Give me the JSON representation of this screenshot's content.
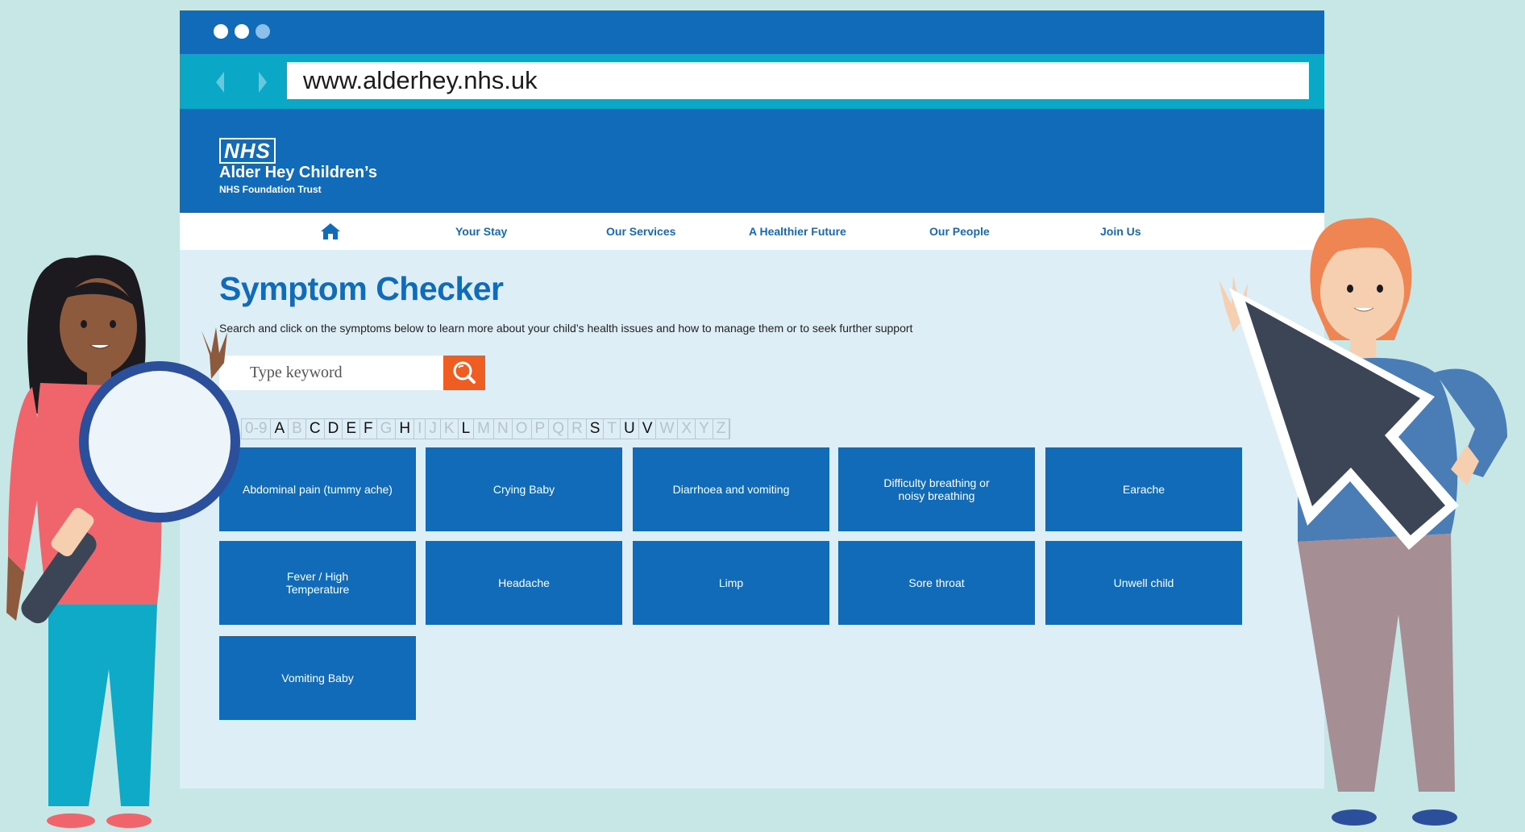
{
  "browser": {
    "url": "www.alderhey.nhs.uk"
  },
  "header": {
    "logo": "NHS",
    "trust_name": "Alder Hey Children’s",
    "trust_sub": "NHS Foundation Trust"
  },
  "nav": {
    "items": [
      "Your Stay",
      "Our Services",
      "A Healthier Future",
      "Our People",
      "Join Us"
    ]
  },
  "main": {
    "title": "Symptom Checker",
    "description": "Search and click on the symptoms below to learn more about your child’s health issues and how to manage them or to seek further support",
    "search_placeholder": "Type keyword"
  },
  "alphabet": [
    {
      "label": "0-9",
      "active": false
    },
    {
      "label": "A",
      "active": true
    },
    {
      "label": "B",
      "active": false
    },
    {
      "label": "C",
      "active": true
    },
    {
      "label": "D",
      "active": true
    },
    {
      "label": "E",
      "active": true
    },
    {
      "label": "F",
      "active": true
    },
    {
      "label": "G",
      "active": false
    },
    {
      "label": "H",
      "active": true
    },
    {
      "label": "I",
      "active": false
    },
    {
      "label": "J",
      "active": false
    },
    {
      "label": "K",
      "active": false
    },
    {
      "label": "L",
      "active": true
    },
    {
      "label": "M",
      "active": false
    },
    {
      "label": "N",
      "active": false
    },
    {
      "label": "O",
      "active": false
    },
    {
      "label": "P",
      "active": false
    },
    {
      "label": "Q",
      "active": false
    },
    {
      "label": "R",
      "active": false
    },
    {
      "label": "S",
      "active": true
    },
    {
      "label": "T",
      "active": false
    },
    {
      "label": "U",
      "active": true
    },
    {
      "label": "V",
      "active": true
    },
    {
      "label": "W",
      "active": false
    },
    {
      "label": "X",
      "active": false
    },
    {
      "label": "Y",
      "active": false
    },
    {
      "label": "Z",
      "active": false
    }
  ],
  "symptoms": [
    "Abdominal pain (tummy ache)",
    "Crying Baby",
    "Diarrhoea and vomiting",
    "Difficulty breathing or\nnoisy breathing",
    "Earache",
    "Fever / High\nTemperature",
    "Headache",
    "Limp",
    "Sore throat",
    "Unwell child",
    "Vomiting Baby"
  ],
  "colors": {
    "nhs_blue": "#126bb8",
    "teal": "#0aa7c7",
    "orange": "#ef5d22",
    "page_bg": "#ddeef6",
    "backdrop": "#c7e6e6"
  },
  "icons": {
    "home": "home-icon",
    "search": "magnifier-icon",
    "back": "chevron-left-icon",
    "forward": "chevron-right-icon"
  }
}
